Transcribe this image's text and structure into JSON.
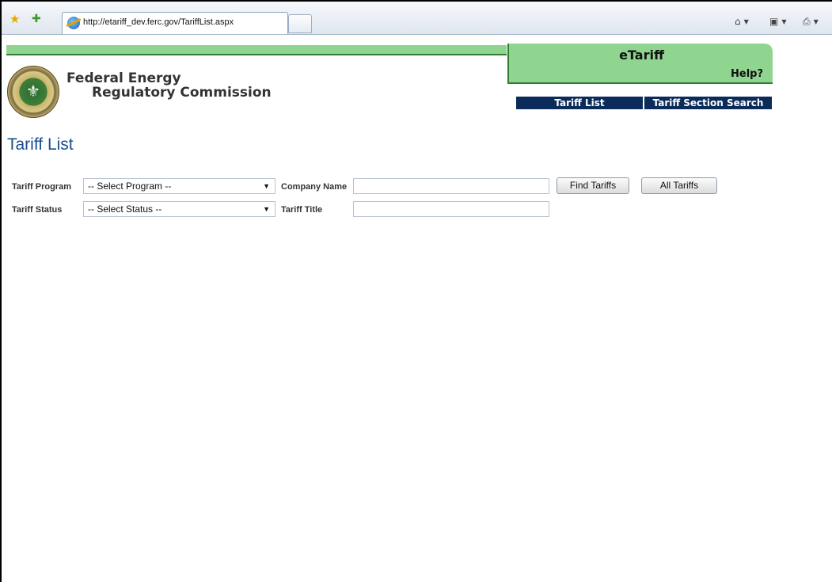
{
  "browser": {
    "tab_title": "http://etariff_dev.ferc.gov/TariffList.aspx",
    "icons": [
      "favorites-star-icon",
      "add-favorites-icon",
      "home-icon",
      "feeds-icon",
      "print-icon"
    ]
  },
  "header": {
    "org_line1": "Federal Energy",
    "org_line2": "Regulatory Commission",
    "app_title": "eTariff",
    "help_label": "Help?",
    "nav": [
      {
        "label": "Tariff List"
      },
      {
        "label": "Tariff Section Search"
      }
    ]
  },
  "page": {
    "title": "Tariff List",
    "form": {
      "program_label": "Tariff Program",
      "program_value": "-- Select Program --",
      "status_label": "Tariff Status",
      "status_value": "-- Select Status --",
      "company_label": "Company Name",
      "company_value": "",
      "title_label": "Tariff Title",
      "title_value": "",
      "find_button": "Find Tariffs",
      "all_button": "All Tariffs"
    }
  },
  "colors": {
    "header_green": "#8fd48f",
    "nav_blue": "#0b2c5a",
    "title_blue": "#1a4e8a"
  }
}
